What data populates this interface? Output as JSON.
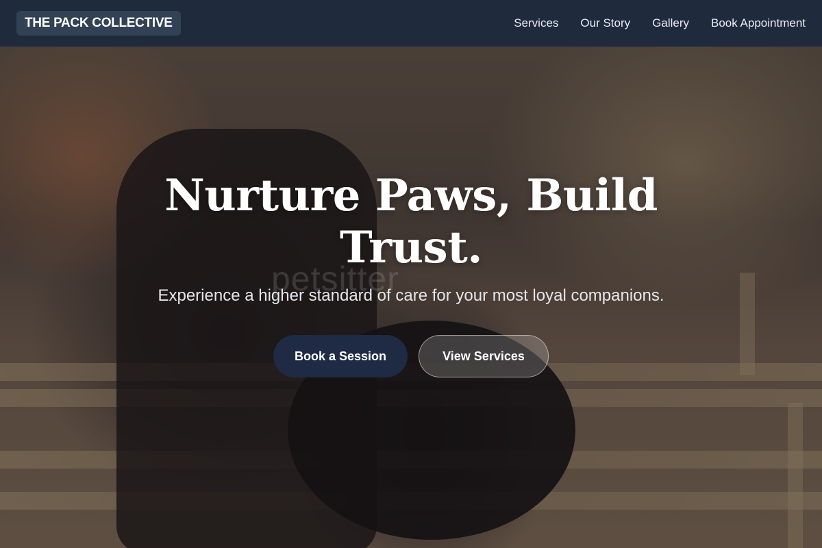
{
  "brand": {
    "name": "THE PACK COLLECTIVE"
  },
  "nav": {
    "items": [
      {
        "label": "Services"
      },
      {
        "label": "Our Story"
      },
      {
        "label": "Gallery"
      },
      {
        "label": "Book Appointment"
      }
    ]
  },
  "hero": {
    "title_line1": "Nurture Paws, Build",
    "title_line2": "Trust.",
    "subtitle": "Experience a higher standard of care for your most loyal companions.",
    "watermark": "petsitter",
    "primary_button": "Book a Session",
    "secondary_button": "View Services"
  },
  "colors": {
    "navbar": "#1f2a3d",
    "primary_button": "#1f2a44",
    "text": "#ffffff"
  }
}
